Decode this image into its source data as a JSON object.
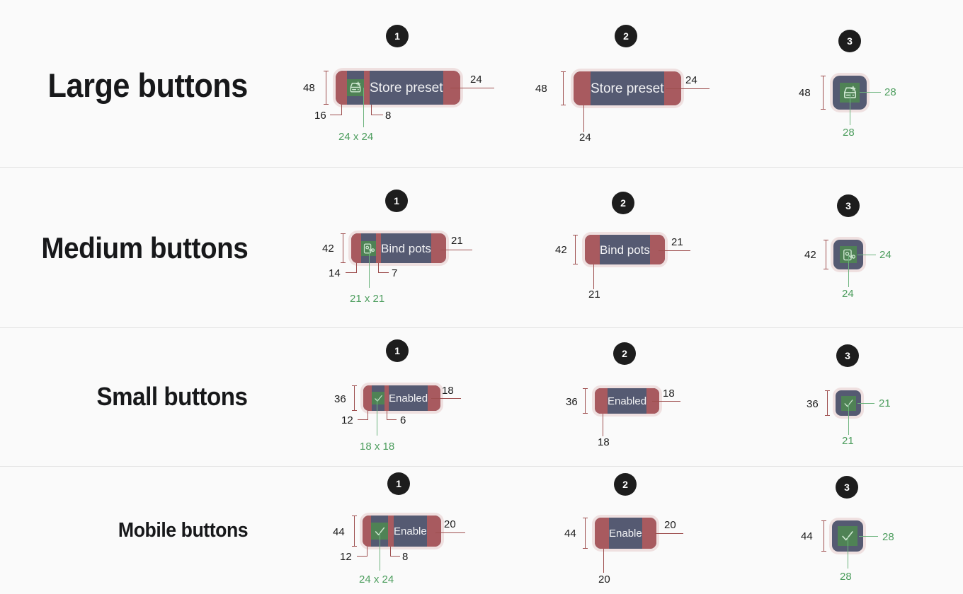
{
  "page": {
    "background": "#fafafa",
    "accent_overlay": "#a85a5f",
    "button_surface": "#555a72",
    "icon_surface": "#4f8255",
    "badge_bg": "#1d1d1d",
    "green_text": "#4c9d5d"
  },
  "rows": [
    {
      "id": "large",
      "title": "Large buttons",
      "height_label": "48",
      "variants": [
        {
          "badge": "1",
          "label": "Store preset",
          "icon": "save-plus-icon",
          "pad_left": "16",
          "pad_gap": "8",
          "pad_right": "24",
          "icon_size": "24 x 24",
          "height": "48"
        },
        {
          "badge": "2",
          "label": "Store preset",
          "pad_left": "24",
          "pad_right": "24",
          "height": "48"
        },
        {
          "badge": "3",
          "icon": "save-plus-icon",
          "icon_w": "28",
          "icon_h": "28",
          "height": "48"
        }
      ]
    },
    {
      "id": "medium",
      "title": "Medium buttons",
      "height_label": "42",
      "variants": [
        {
          "badge": "1",
          "label": "Bind pots",
          "icon": "bind-link-icon",
          "pad_left": "14",
          "pad_gap": "7",
          "pad_right": "21",
          "icon_size": "21 x 21",
          "height": "42"
        },
        {
          "badge": "2",
          "label": "Bind pots",
          "pad_left": "21",
          "pad_right": "21",
          "height": "42"
        },
        {
          "badge": "3",
          "icon": "bind-link-icon",
          "icon_w": "24",
          "icon_h": "24",
          "height": "42"
        }
      ]
    },
    {
      "id": "small",
      "title": "Small buttons",
      "height_label": "36",
      "variants": [
        {
          "badge": "1",
          "label": "Enabled",
          "icon": "check-icon",
          "pad_left": "12",
          "pad_gap": "6",
          "pad_right": "18",
          "icon_size": "18 x 18",
          "height": "36"
        },
        {
          "badge": "2",
          "label": "Enabled",
          "pad_left": "18",
          "pad_right": "18",
          "height": "36"
        },
        {
          "badge": "3",
          "icon": "check-icon",
          "icon_w": "21",
          "icon_h": "21",
          "height": "36"
        }
      ]
    },
    {
      "id": "mobile",
      "title": "Mobile buttons",
      "height_label": "44",
      "variants": [
        {
          "badge": "1",
          "label": "Enable",
          "icon": "check-icon",
          "pad_left": "12",
          "pad_gap": "8",
          "pad_right": "20",
          "icon_size": "24 x 24",
          "height": "44"
        },
        {
          "badge": "2",
          "label": "Enable",
          "pad_left": "20",
          "pad_right": "20",
          "height": "44"
        },
        {
          "badge": "3",
          "icon": "check-icon",
          "icon_w": "28",
          "icon_h": "28",
          "height": "44"
        }
      ]
    }
  ]
}
